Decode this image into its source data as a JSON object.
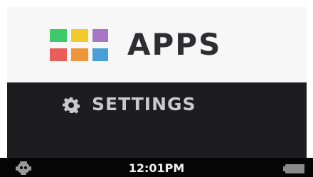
{
  "menu": {
    "apps": {
      "label": "APPS",
      "icon": "apps-grid-icon",
      "tile_colors": [
        "#3ec96b",
        "#f2cc2c",
        "#a877c4",
        "#e85f5a",
        "#f0953a",
        "#4b9fd8"
      ]
    },
    "settings": {
      "label": "SETTINGS",
      "icon": "gear-icon"
    }
  },
  "status_bar": {
    "time": "12:01PM",
    "left_icon": "robot-icon",
    "right_icon": "battery-icon"
  },
  "colors": {
    "selected_bg": "#f7f7f7",
    "screen_bg": "#1d1d20",
    "status_bg": "#050505"
  }
}
